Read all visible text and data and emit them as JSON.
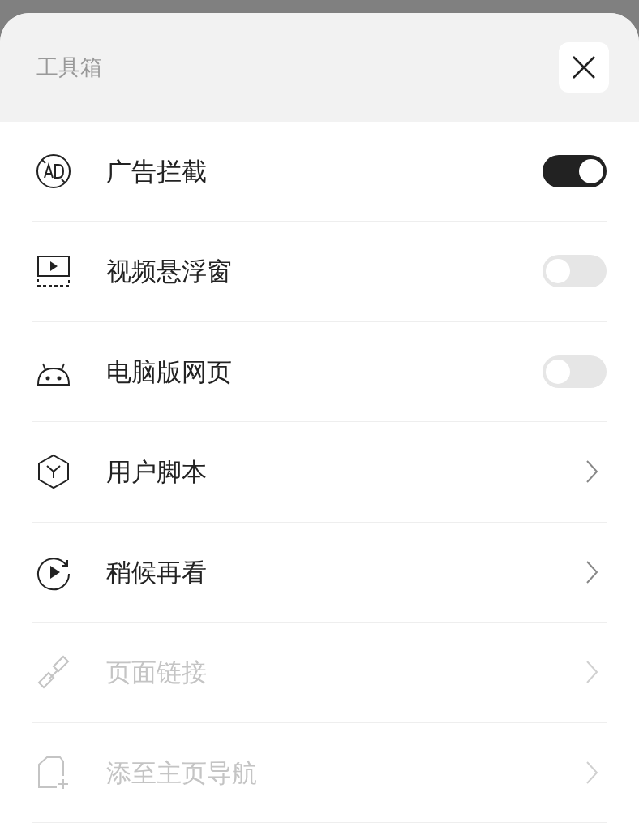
{
  "sheet": {
    "title": "工具箱"
  },
  "items": [
    {
      "label": "广告拦截",
      "kind": "toggle",
      "on": true,
      "disabled": false
    },
    {
      "label": "视频悬浮窗",
      "kind": "toggle",
      "on": false,
      "disabled": false
    },
    {
      "label": "电脑版网页",
      "kind": "toggle",
      "on": false,
      "disabled": false
    },
    {
      "label": "用户脚本",
      "kind": "link",
      "disabled": false
    },
    {
      "label": "稍候再看",
      "kind": "link",
      "disabled": false
    },
    {
      "label": "页面链接",
      "kind": "link",
      "disabled": true
    },
    {
      "label": "添至主页导航",
      "kind": "link",
      "disabled": true
    }
  ]
}
